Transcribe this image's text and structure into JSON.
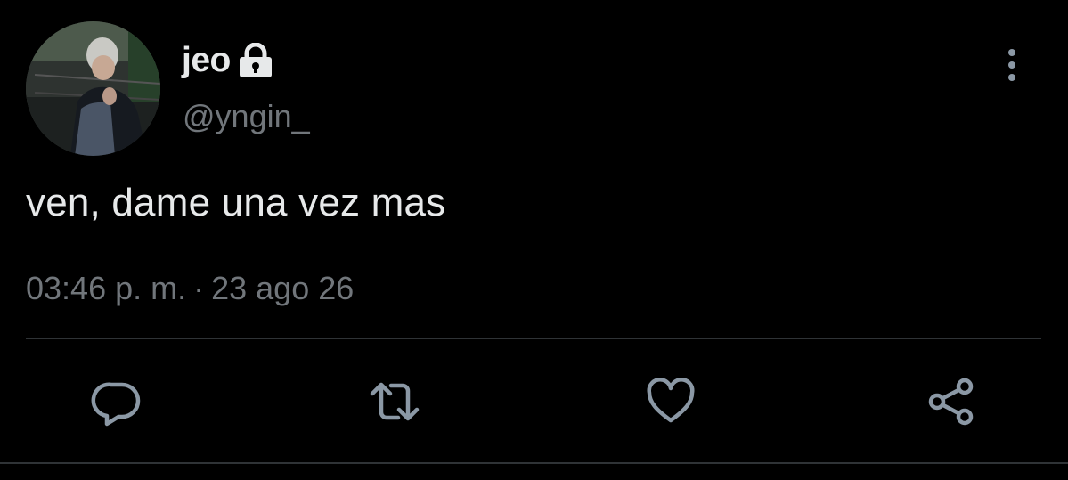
{
  "user": {
    "display_name": "jeo",
    "handle": "@yngin_",
    "protected_icon": "lock-icon",
    "avatar": "profile-photo"
  },
  "tweet": {
    "text": "ven, dame una vez mas",
    "time": "03:46 p. m.",
    "separator": "·",
    "date": "23 ago 26"
  },
  "actions": {
    "reply_icon": "reply-icon",
    "retweet_icon": "retweet-icon",
    "like_icon": "heart-icon",
    "share_icon": "share-icon",
    "more_icon": "more-vertical-icon"
  },
  "colors": {
    "background": "#000000",
    "primary_text": "#e7e9ea",
    "secondary_text": "#71767b",
    "divider": "#2f3336"
  }
}
